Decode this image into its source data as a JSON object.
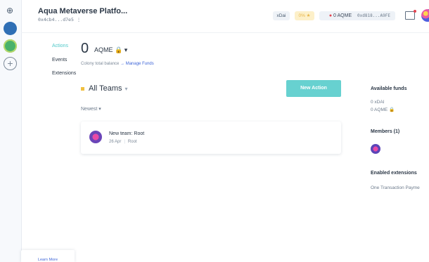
{
  "rail": {
    "globe_icon": "globe-icon",
    "plus_label": "+"
  },
  "header": {
    "colony_name": "Aqua Metaverse Platfo...",
    "colony_address": "0x4cb4...d7e5 ⋮",
    "network": "xDai",
    "reputation": "0% ★",
    "balance": "0 AQME",
    "wallet": "0xd818...A9FE"
  },
  "nav": {
    "items": [
      "Actions",
      "Events",
      "Extensions"
    ]
  },
  "balance": {
    "amount": "0",
    "token": "AQME 🔒 ▾",
    "subtitle": "Colony total balance",
    "manage_link": "→ Manage Funds"
  },
  "teams": {
    "label": "All Teams",
    "new_action": "New Action",
    "sort": "Newest ▾"
  },
  "actions": [
    {
      "title": "New team: Root",
      "date": "26 Apr",
      "team": "Root"
    }
  ],
  "side": {
    "funds_title": "Available funds",
    "funds": [
      "0 xDAI",
      "0 AQME 🔒"
    ],
    "members_title": "Members (1)",
    "extensions_title": "Enabled extensions",
    "extensions": [
      "One Transaction Payme"
    ]
  },
  "footer": {
    "learn_more": "Learn More"
  },
  "colors": {
    "accent": "#67d1d0",
    "link": "#3f66d8",
    "alert": "#e2434f"
  }
}
